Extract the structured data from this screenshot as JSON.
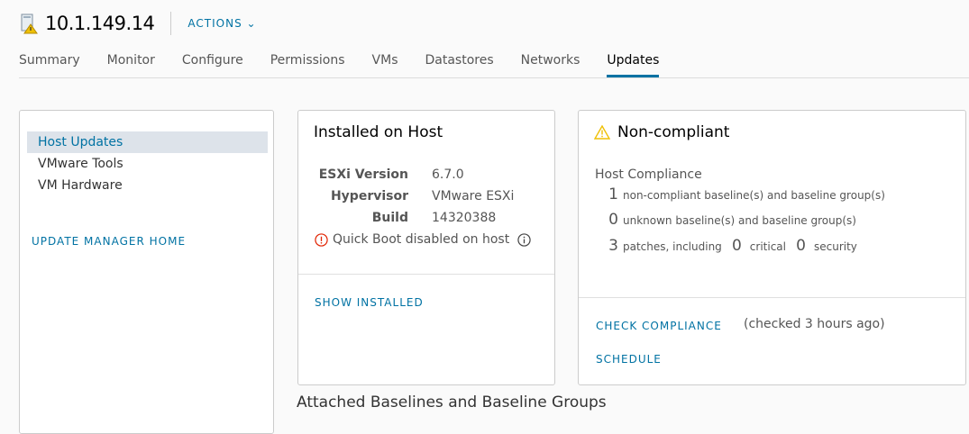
{
  "header": {
    "title": "10.1.149.14",
    "actions_label": "ACTIONS"
  },
  "tabs": [
    {
      "label": "Summary"
    },
    {
      "label": "Monitor"
    },
    {
      "label": "Configure"
    },
    {
      "label": "Permissions"
    },
    {
      "label": "VMs"
    },
    {
      "label": "Datastores"
    },
    {
      "label": "Networks"
    },
    {
      "label": "Updates",
      "active": true
    }
  ],
  "sidebar": {
    "items": [
      {
        "label": "Host Updates"
      },
      {
        "label": "VMware Tools"
      },
      {
        "label": "VM Hardware"
      }
    ],
    "home_link": "UPDATE MANAGER HOME"
  },
  "installed": {
    "title": "Installed on Host",
    "esxi_version_label": "ESXi Version",
    "esxi_version": "6.7.0",
    "hypervisor_label": "Hypervisor",
    "hypervisor": "VMware ESXi",
    "build_label": "Build",
    "build": "14320388",
    "quick_boot": "Quick Boot disabled on host",
    "show_installed": "SHOW INSTALLED"
  },
  "compliance": {
    "status": "Non-compliant",
    "section": "Host Compliance",
    "noncompliant_count": "1",
    "noncompliant_text": "non-compliant baseline(s) and baseline group(s)",
    "unknown_count": "0",
    "unknown_text": "unknown baseline(s) and baseline group(s)",
    "patches_count": "3",
    "patches_text": "patches, including",
    "critical_count": "0",
    "critical_text": "critical",
    "security_count": "0",
    "security_text": "security",
    "check_label": "CHECK COMPLIANCE",
    "checked_text": "(checked 3 hours ago)",
    "schedule_label": "SCHEDULE"
  },
  "baselines_heading": "Attached Baselines and Baseline Groups",
  "colors": {
    "accent": "#0072a3",
    "warning": "#efc006",
    "error": "#e12200"
  }
}
